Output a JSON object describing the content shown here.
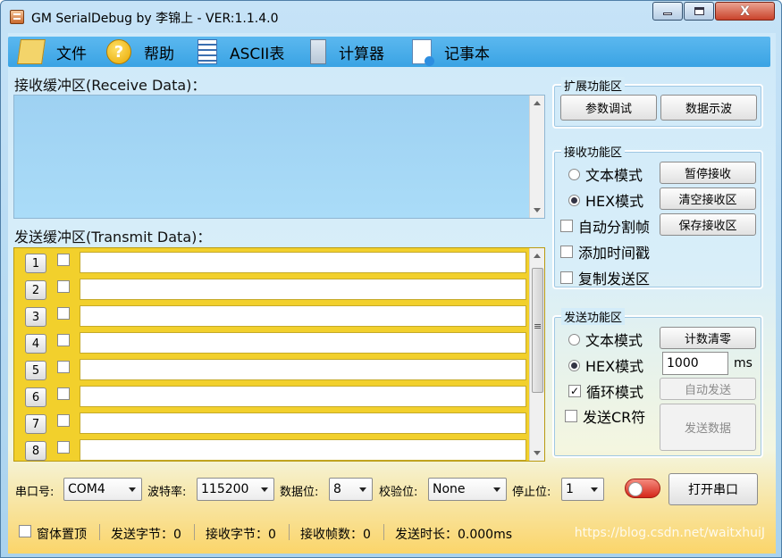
{
  "window": {
    "title": "GM SerialDebug by 李锦上 - VER:1.1.4.0",
    "icons": [
      "app-icon",
      "minimize-icon",
      "maximize-icon",
      "close-icon"
    ],
    "close_glyph": "X"
  },
  "menu": {
    "items": [
      {
        "label": "文件",
        "icon": "file-icon"
      },
      {
        "label": "帮助",
        "icon": "help-icon",
        "glyph": "?"
      },
      {
        "label": "ASCII表",
        "icon": "ascii-table-icon"
      },
      {
        "label": "计算器",
        "icon": "calculator-icon"
      },
      {
        "label": "记事本",
        "icon": "notepad-icon"
      }
    ]
  },
  "receive": {
    "label": "接收缓冲区(Receive Data)："
  },
  "transmit": {
    "label": "发送缓冲区(Transmit Data)：",
    "rows": [
      {
        "num": "1",
        "value": ""
      },
      {
        "num": "2",
        "value": ""
      },
      {
        "num": "3",
        "value": ""
      },
      {
        "num": "4",
        "value": ""
      },
      {
        "num": "5",
        "value": ""
      },
      {
        "num": "6",
        "value": ""
      },
      {
        "num": "7",
        "value": ""
      },
      {
        "num": "8",
        "value": ""
      }
    ]
  },
  "ext_panel": {
    "title": "扩展功能区",
    "param_debug": "参数调试",
    "data_scope": "数据示波"
  },
  "recv_panel": {
    "title": "接收功能区",
    "text_mode": "文本模式",
    "hex_mode": "HEX模式",
    "selected_mode": "HEX模式",
    "auto_split": "自动分割帧",
    "add_timestamp": "添加时间戳",
    "copy_send": "复制发送区",
    "pause_recv": "暂停接收",
    "clear_recv": "清空接收区",
    "save_recv": "保存接收区"
  },
  "send_panel": {
    "title": "发送功能区",
    "text_mode": "文本模式",
    "hex_mode": "HEX模式",
    "selected_mode": "HEX模式",
    "reset_count": "计数清零",
    "interval_value": "1000",
    "interval_unit": "ms",
    "loop_mode": "循环模式",
    "loop_checked": true,
    "loop_check_glyph": "✓",
    "send_cr": "发送CR符",
    "auto_send": "自动发送",
    "send_data": "发送数据"
  },
  "serial": {
    "port_label": "串口号:",
    "port_value": "COM4",
    "baud_label": "波特率:",
    "baud_value": "115200",
    "data_bits_label": "数据位:",
    "data_bits_value": "8",
    "parity_label": "校验位:",
    "parity_value": "None",
    "stop_bits_label": "停止位:",
    "stop_bits_value": "1",
    "open_button": "打开串口",
    "toggle_on": false,
    "status_color": "#d4271a"
  },
  "statusbar": {
    "always_on_top": "窗体置顶",
    "sent_bytes": "发送字节：0",
    "recv_bytes": "接收字节：0",
    "recv_frames": "接收帧数：0",
    "send_duration": "发送时长：0.000ms",
    "watermark": "https://blog.csdn.net/waitxhuiJ"
  }
}
